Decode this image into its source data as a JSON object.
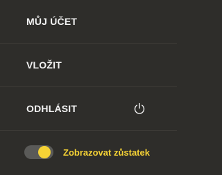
{
  "menu": {
    "items": [
      {
        "label": "MŮJ ÚČET"
      },
      {
        "label": "VLOŽIT"
      },
      {
        "label": "ODHLÁSIT",
        "icon": "power-icon"
      }
    ]
  },
  "balance_toggle": {
    "label": "Zobrazovat zůstatek",
    "on": true
  },
  "colors": {
    "background": "#2e2d2a",
    "divider": "#3d3b37",
    "text": "#f2f2f2",
    "accent": "#f5d235",
    "toggle_track": "#5a5a58"
  }
}
